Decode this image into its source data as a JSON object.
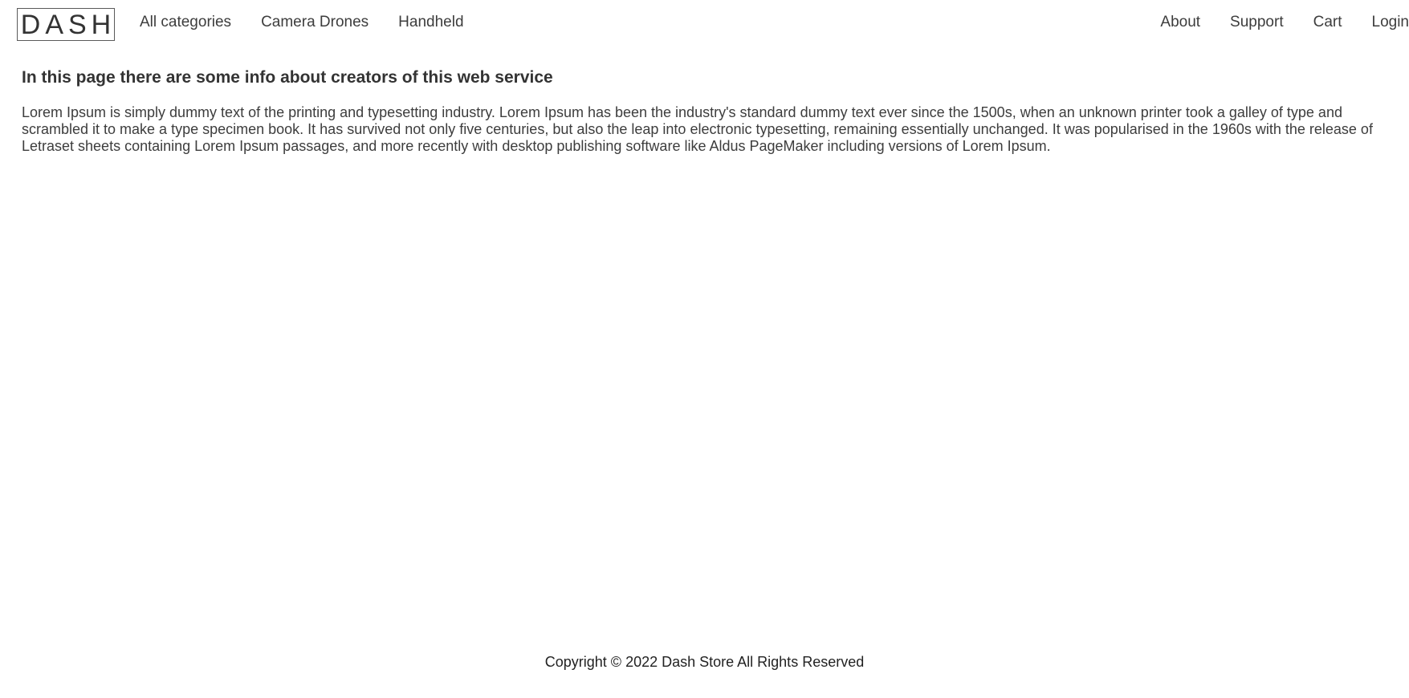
{
  "header": {
    "logo": "DASH",
    "nav_left": [
      {
        "label": "All categories"
      },
      {
        "label": "Camera Drones"
      },
      {
        "label": "Handheld"
      }
    ],
    "nav_right": [
      {
        "label": "About"
      },
      {
        "label": "Support"
      },
      {
        "label": "Cart"
      },
      {
        "label": "Login"
      }
    ]
  },
  "main": {
    "title": "In this page there are some info about creators of this web service",
    "text": "Lorem Ipsum is simply dummy text of the printing and typesetting industry. Lorem Ipsum has been the industry's standard dummy text ever since the 1500s, when an unknown printer took a galley of type and scrambled it to make a type specimen book. It has survived not only five centuries, but also the leap into electronic typesetting, remaining essentially unchanged. It was popularised in the 1960s with the release of Letraset sheets containing Lorem Ipsum passages, and more recently with desktop publishing software like Aldus PageMaker including versions of Lorem Ipsum."
  },
  "footer": {
    "copyright": "Copyright © 2022 Dash Store All Rights Reserved"
  }
}
